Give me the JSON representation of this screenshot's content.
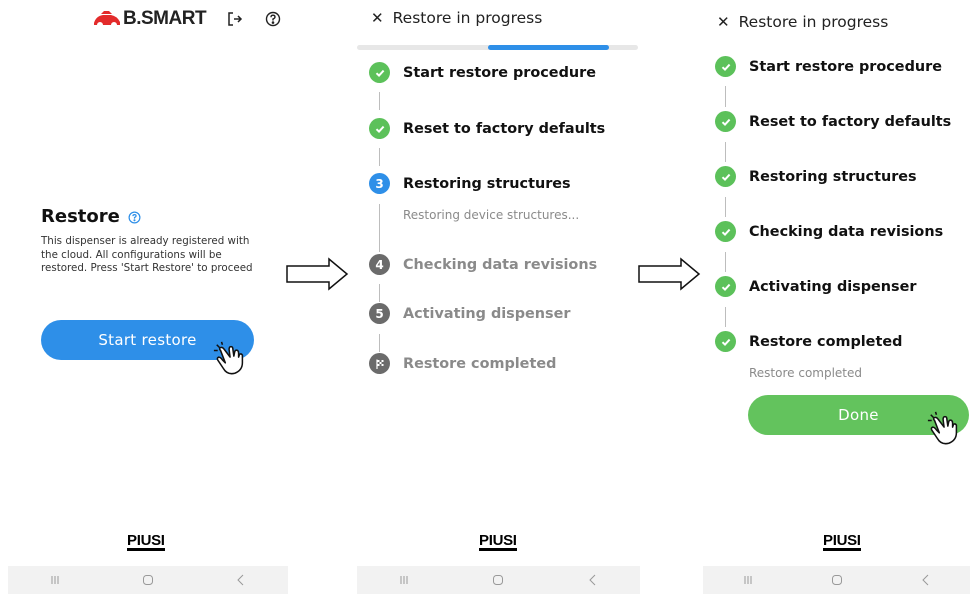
{
  "screen1": {
    "brand": "B.SMART",
    "restore_title": "Restore",
    "restore_description": "This dispenser is already registered with the cloud. All configurations will be restored. Press 'Start Restore' to proceed",
    "start_button_label": "Start restore",
    "footer_logo": "PIUSI"
  },
  "screen2": {
    "header_title": "Restore in progress",
    "close_glyph": "✕",
    "progress_fraction": 0.43,
    "steps": [
      {
        "label": "Start restore procedure",
        "state": "done",
        "number": ""
      },
      {
        "label": "Reset to factory defaults",
        "state": "done",
        "number": ""
      },
      {
        "label": "Restoring structures",
        "state": "active",
        "number": "3"
      },
      {
        "label": "Checking data revisions",
        "state": "pending",
        "number": "4"
      },
      {
        "label": "Activating dispenser",
        "state": "pending",
        "number": "5"
      },
      {
        "label": "Restore completed",
        "state": "pending",
        "number": ""
      }
    ],
    "active_substatus": "Restoring device structures...",
    "footer_logo": "PIUSI"
  },
  "screen3": {
    "header_title": "Restore in progress",
    "close_glyph": "✕",
    "steps": [
      {
        "label": "Start restore procedure",
        "state": "done"
      },
      {
        "label": "Reset to factory defaults",
        "state": "done"
      },
      {
        "label": "Restoring structures",
        "state": "done"
      },
      {
        "label": "Checking data revisions",
        "state": "done"
      },
      {
        "label": "Activating dispenser",
        "state": "done"
      },
      {
        "label": "Restore completed",
        "state": "done"
      }
    ],
    "completed_substatus": "Restore completed",
    "done_button_label": "Done",
    "footer_logo": "PIUSI"
  },
  "icons": {
    "logout": "logout-icon",
    "help": "help-icon",
    "info": "info-icon",
    "check": "check-icon",
    "flag": "checkered-flag-icon",
    "hand": "pointing-hand-icon",
    "arrow": "right-arrow-icon",
    "nav_recent": "recent-apps-icon",
    "nav_home": "home-icon",
    "nav_back": "back-icon"
  },
  "colors": {
    "primary_blue": "#2e8fe8",
    "success_green": "#5cc15a",
    "pending_gray": "#6b6b6b",
    "brand_red": "#e32b2b"
  }
}
